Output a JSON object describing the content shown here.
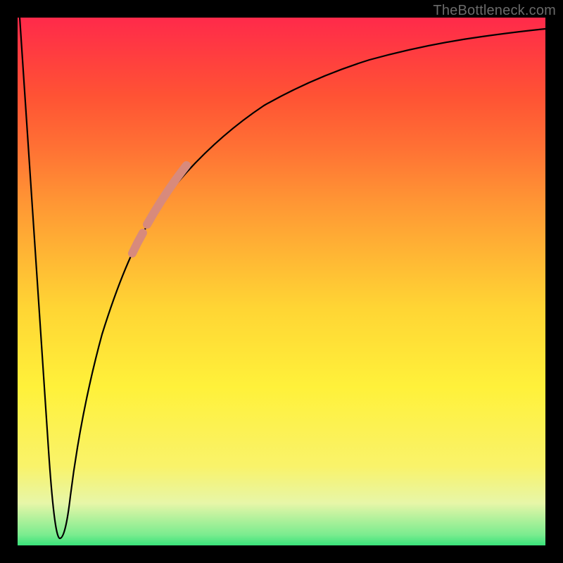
{
  "attribution": "TheBottleneck.com",
  "chart_data": {
    "type": "line",
    "title": "",
    "xlabel": "",
    "ylabel": "",
    "xlim": [
      0,
      100
    ],
    "ylim": [
      0,
      100
    ],
    "grid": false,
    "series": [
      {
        "name": "bottleneck-curve",
        "x": [
          0,
          5,
          7,
          8,
          9,
          10,
          12,
          15,
          18,
          20,
          23,
          26,
          30,
          35,
          40,
          45,
          50,
          55,
          60,
          65,
          70,
          75,
          80,
          85,
          90,
          95,
          100
        ],
        "values": [
          100,
          20,
          3,
          2,
          3,
          8,
          20,
          35,
          47,
          53,
          60,
          66,
          72,
          78,
          82,
          85,
          88,
          90,
          91.5,
          93,
          94,
          95,
          95.8,
          96.5,
          97,
          97.5,
          98
        ]
      }
    ],
    "highlights": [
      {
        "name": "segment-lower",
        "x_range": [
          19,
          21
        ],
        "y_range": [
          51,
          56
        ]
      },
      {
        "name": "segment-upper",
        "x_range": [
          21,
          27
        ],
        "y_range": [
          56,
          68
        ]
      }
    ],
    "background_gradient": {
      "bottom": "#39e27a",
      "mid": "#fff13a",
      "top": "#ff2a4a"
    }
  }
}
